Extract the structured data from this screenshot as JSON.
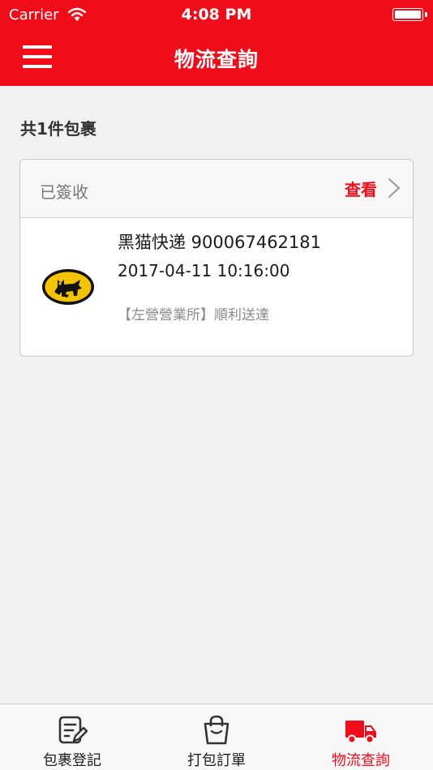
{
  "status_bar": {
    "carrier": "Carrier",
    "time": "4:08 PM"
  },
  "nav": {
    "title": "物流查詢",
    "menu_icon": "hamburger-menu-icon"
  },
  "summary": {
    "count_label": "共1件包裹"
  },
  "package": {
    "status": "已簽收",
    "view_label": "查看",
    "courier_and_number": "黑猫快递 900067462181",
    "datetime": "2017-04-11 10:16:00",
    "latest_event": "【左營營業所】順利送達",
    "logo_icon": "black-cat-logo-icon"
  },
  "tabs": [
    {
      "label": "包裹登記",
      "icon": "form-edit-icon",
      "active": false
    },
    {
      "label": "打包訂單",
      "icon": "shopping-bag-icon",
      "active": false
    },
    {
      "label": "物流查詢",
      "icon": "delivery-truck-icon",
      "active": true
    }
  ],
  "colors": {
    "brand": "#f00d1a",
    "background": "#f1f1f1",
    "card_border": "#c9c9c9"
  }
}
